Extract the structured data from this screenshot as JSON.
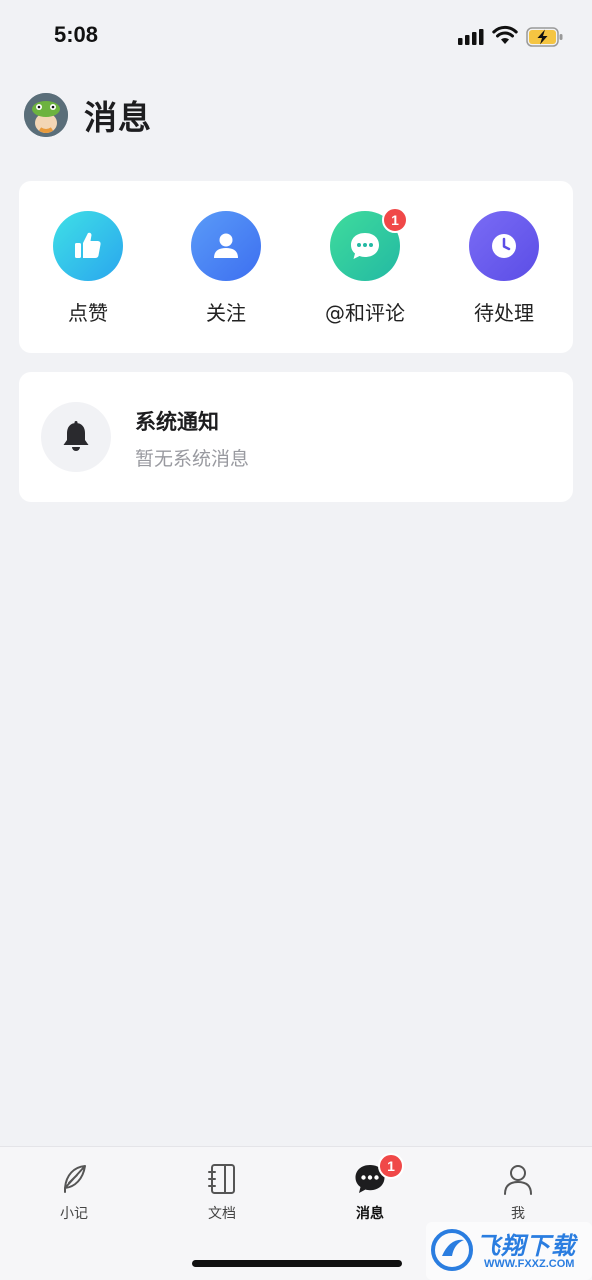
{
  "status_bar": {
    "time": "5:08"
  },
  "header": {
    "title": "消息"
  },
  "actions": [
    {
      "label": "点赞",
      "icon": "thumbs-up-icon",
      "color": "#2fc9e0",
      "badge": ""
    },
    {
      "label": "关注",
      "icon": "person-icon",
      "color": "#4f86f5",
      "badge": ""
    },
    {
      "label": "@和评论",
      "icon": "chat-bubble-icon",
      "color": "#2dc99a",
      "badge": "1"
    },
    {
      "label": "待处理",
      "icon": "clock-icon",
      "color": "#6a5cf0",
      "badge": ""
    }
  ],
  "system_notice": {
    "title": "系统通知",
    "subtitle": "暂无系统消息"
  },
  "tabs": [
    {
      "label": "小记",
      "icon": "feather-icon",
      "active": false
    },
    {
      "label": "文档",
      "icon": "notebook-icon",
      "active": false
    },
    {
      "label": "消息",
      "icon": "message-icon",
      "active": true,
      "badge": "1"
    },
    {
      "label": "我",
      "icon": "user-icon",
      "active": false
    }
  ],
  "watermark": {
    "name": "飞翔下载",
    "url": "WWW.FXXZ.COM"
  }
}
